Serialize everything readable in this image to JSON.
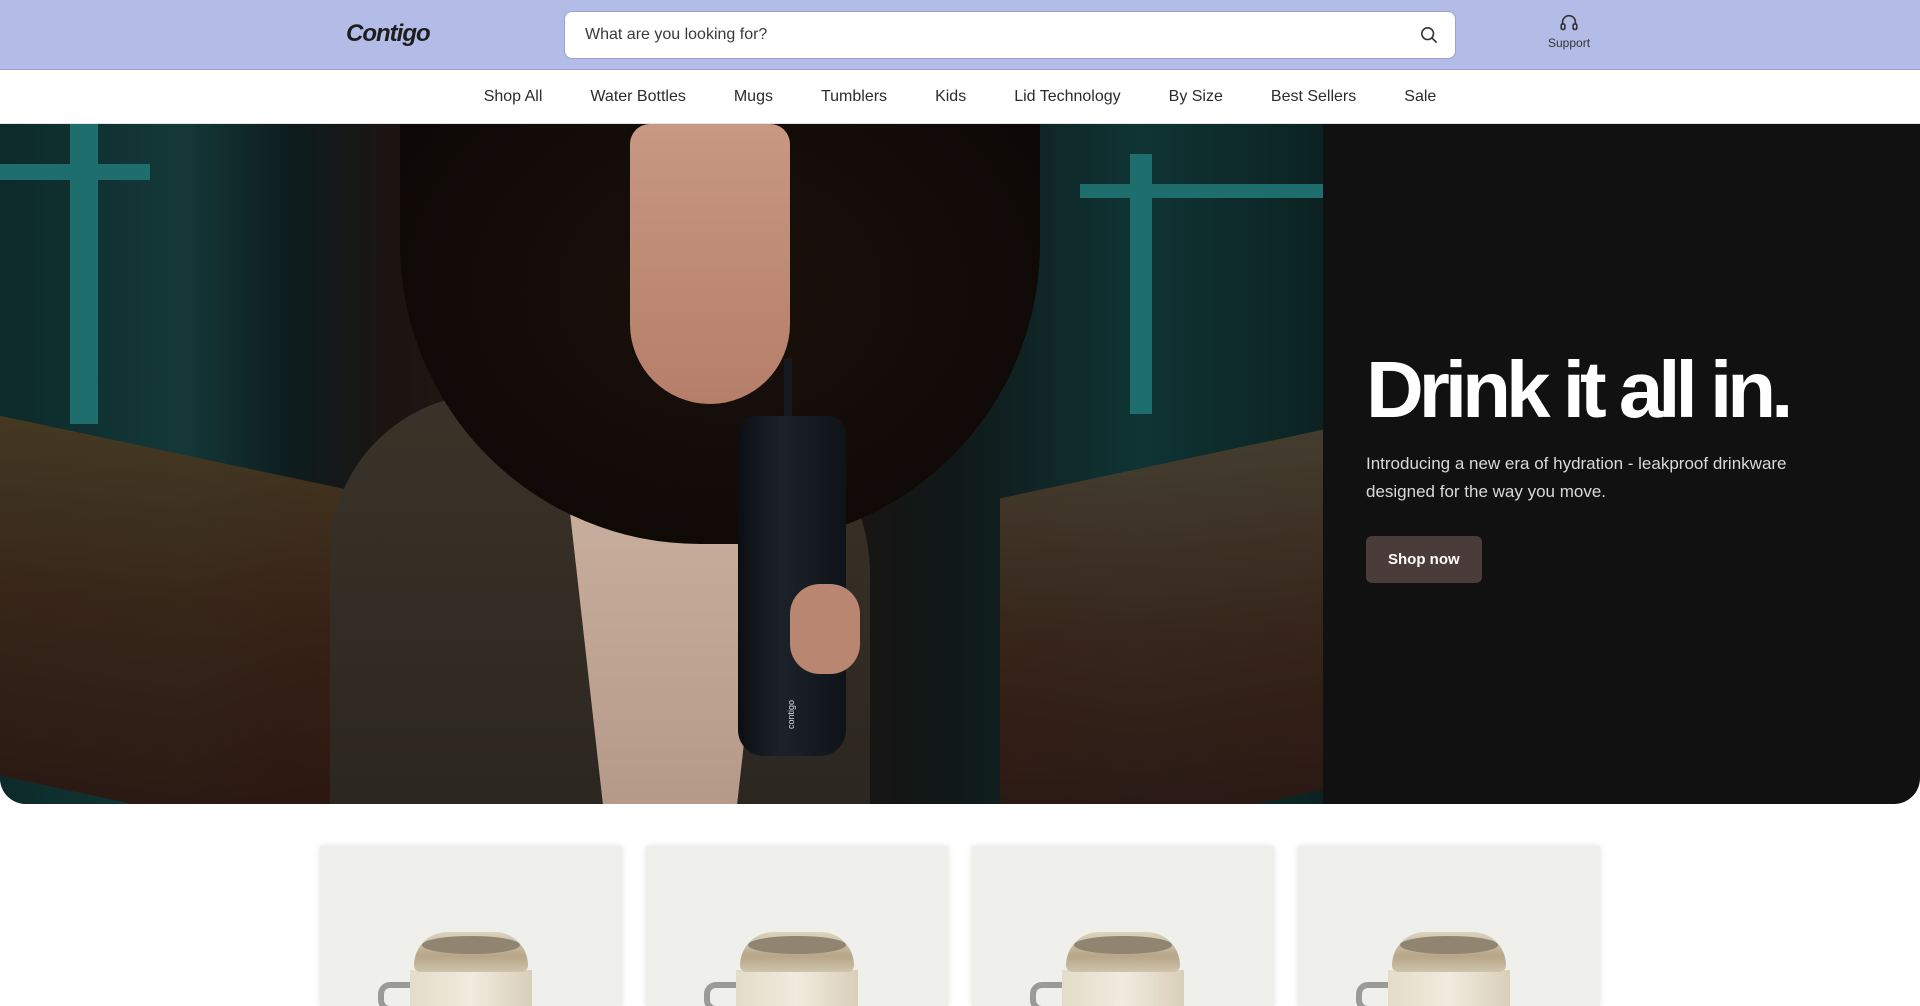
{
  "header": {
    "logo": "Contigo",
    "search_placeholder": "What are you looking for?",
    "search_icon": "search-icon",
    "support_label": "Support",
    "support_icon": "headset-icon",
    "bg_color": "#b3bce6"
  },
  "nav": {
    "items": [
      {
        "label": "Shop All"
      },
      {
        "label": "Water Bottles"
      },
      {
        "label": "Mugs"
      },
      {
        "label": "Tumblers"
      },
      {
        "label": "Kids"
      },
      {
        "label": "Lid Technology"
      },
      {
        "label": "By Size"
      },
      {
        "label": "Best Sellers"
      },
      {
        "label": "Sale"
      }
    ]
  },
  "hero": {
    "title": "Drink it all in.",
    "subtitle": "Introducing a new era of hydration - leakproof drinkware designed for the way you move.",
    "cta_label": "Shop now",
    "bottle_brand": "contigo",
    "bg_color": "#111111",
    "cta_color": "#4a3c38"
  },
  "products": {
    "cards": [
      {
        "image": "mug-image"
      },
      {
        "image": "mug-image"
      },
      {
        "image": "mug-image"
      },
      {
        "image": "mug-image"
      }
    ]
  }
}
